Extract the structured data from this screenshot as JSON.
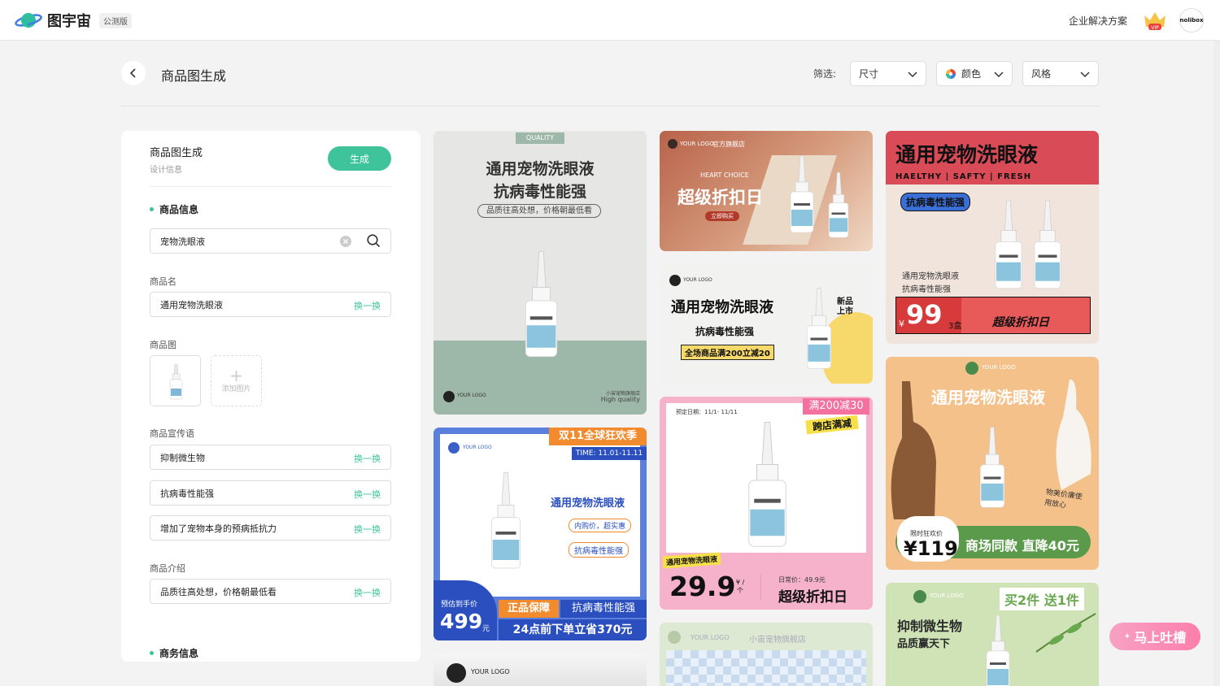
{
  "app": {
    "name": "图宇宙",
    "badge": "公测版",
    "enterprise": "企业解决方案",
    "vip": "VIP",
    "avatar": "nolibox"
  },
  "page": {
    "title": "商品图生成"
  },
  "filters": {
    "label": "筛选:",
    "size": "尺寸",
    "color": "颜色",
    "style": "风格"
  },
  "panel": {
    "title": "商品图生成",
    "subtitle": "设计信息",
    "generate": "生成",
    "product_info": "商品信息",
    "search_value": "宠物洗眼液",
    "name_label": "商品名",
    "name_value": "通用宠物洗眼液",
    "swap": "换一换",
    "image_label": "商品图",
    "add_image": "添加图片",
    "slogan_label": "商品宣传语",
    "slogans": [
      "抑制微生物",
      "抗病毒性能强",
      "增加了宠物本身的预病抵抗力"
    ],
    "intro_label": "商品介绍",
    "intro_value": "品质往高处想，价格朝最低看",
    "business_info": "商务信息"
  },
  "cards": {
    "c1": {
      "tag": "QUALITY",
      "title1": "通用宠物洗眼液",
      "title2": "抗病毒性能强",
      "sub": "品质往高处想，价格朝最低看",
      "logo": "YOUR LOGO",
      "foot1": "小宙宠物旗舰店",
      "foot2": "High quality"
    },
    "c2": {
      "logo": "YOUR LOGO",
      "store": "官方旗舰店",
      "brand": "HEART CHOICE",
      "title": "超级折扣日",
      "btn": "立即购买"
    },
    "c3": {
      "logo": "YOUR LOGO",
      "title": "通用宠物洗眼液",
      "sub": "抗病毒性能强",
      "promo": "全场商品满200立减20",
      "new": "新品上市"
    },
    "c4": {
      "title": "通用宠物洗眼液",
      "tags": "HAELTHY | SAFTY | FRESH",
      "badge": "抗病毒性能强",
      "desc1": "通用宠物洗眼液",
      "desc2": "抗病毒性能强",
      "cur": "¥",
      "price": "99",
      "unit": "3盒",
      "banner": "超级折扣日"
    },
    "c5": {
      "logo": "YOUR LOGO",
      "top": "双11全球狂欢季",
      "time": "TIME: 11.01-11.11",
      "title": "通用宠物洗眼液",
      "p1": "内购价，超实惠",
      "p2": "抗病毒性能强",
      "est": "预估到手价",
      "price": "499",
      "yuan": "元",
      "b1": "正品保障",
      "b2": "抗病毒性能强",
      "b3": "24点前下单立省370元"
    },
    "c6": {
      "date": "预定日期：11/1- 11/11",
      "r1": "满200减30",
      "r2": "跨店满减",
      "label": "通用宠物洗眼液",
      "price": "29.9",
      "unit": "¥ /个",
      "orig": "日常价：49.9元",
      "title": "超级折扣日"
    },
    "c7": {
      "logo": "YOUR LOGO",
      "title": "通用宠物洗眼液",
      "bubble": "物美价廉使用放心",
      "limit": "限时狂欢价",
      "price": "¥119",
      "deal": "商场同款 直降40元"
    },
    "c8": {
      "logo": "YOUR LOGO"
    },
    "c9": {
      "logo": "YOUR LOGO",
      "store": "小宙宠物旗舰店"
    },
    "c10": {
      "logo": "YOUR LOGO",
      "tag": "买2件 送1件",
      "t1": "抑制微生物",
      "t2": "品质赢天下"
    }
  },
  "feedback": "马上吐槽",
  "colors": {
    "accent": "#3ec39b",
    "feedback": "#fd7eab"
  }
}
